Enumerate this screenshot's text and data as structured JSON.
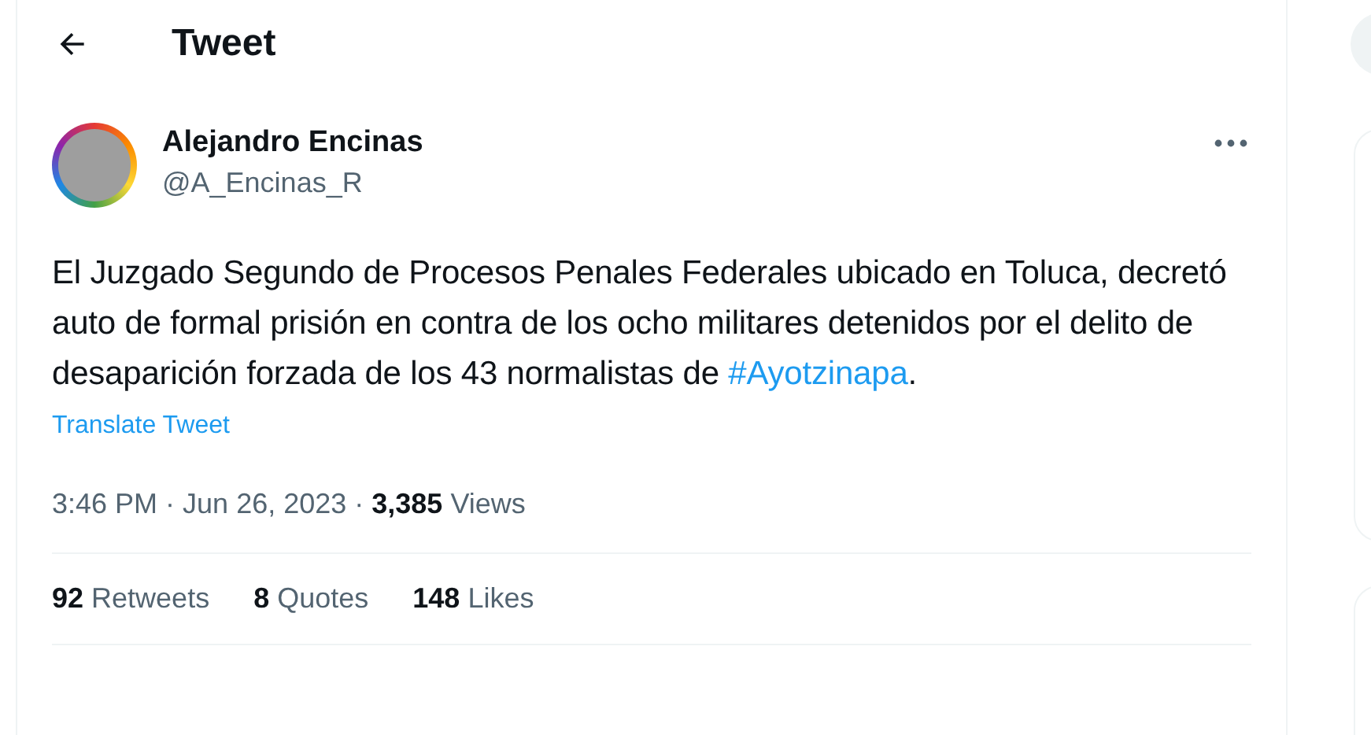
{
  "header": {
    "title": "Tweet"
  },
  "author": {
    "name": "Alejandro Encinas",
    "handle": "@A_Encinas_R"
  },
  "tweet": {
    "text": "El Juzgado Segundo de Procesos Penales Federales ubicado en Toluca, decretó auto de formal prisión en contra de los ocho militares detenidos por el delito de desaparición forzada de los 43 normalistas de",
    "hashtag": "#Ayotzinapa",
    "text_end": ".",
    "translate": "Translate Tweet"
  },
  "meta": {
    "time": "3:46 PM",
    "separator_1": "·",
    "date": "Jun 26, 2023",
    "separator_2": "·",
    "views": "**3,385** Views"
  },
  "stats": [
    {
      "label": "**92** Retweets"
    },
    {
      "label": "**8** Quotes"
    },
    {
      "label": "**148** Likes"
    }
  ]
}
